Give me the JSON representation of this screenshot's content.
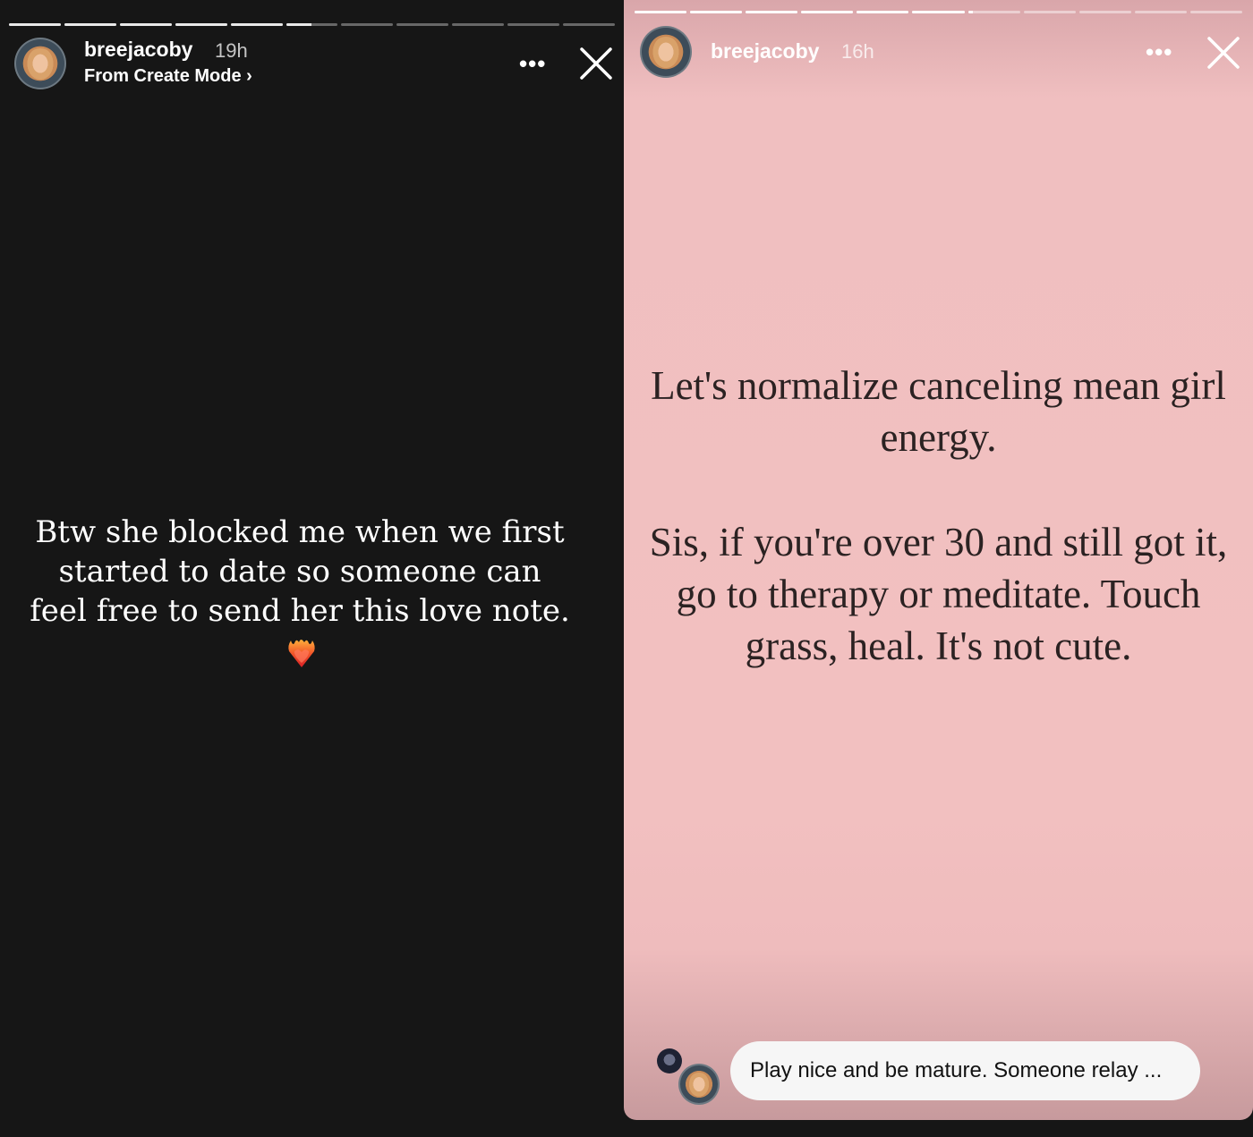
{
  "left_story": {
    "progress": {
      "segments": 11,
      "current": 5,
      "current_fill": 0.5
    },
    "user": {
      "username": "breejacoby",
      "time": "19h",
      "subtitle": "From Create Mode ›"
    },
    "more_label": "•••",
    "caption": "Btw she blocked me when we first started to date so someone can feel free to send her this love note.",
    "emoji": "heart-on-fire-icon",
    "background": "#161616"
  },
  "right_story": {
    "progress": {
      "segments": 11,
      "current": 6,
      "current_fill": 0.1
    },
    "user": {
      "username": "breejacoby",
      "time": "16h"
    },
    "more_label": "•••",
    "quote_line1": "Let's normalize canceling mean girl energy.",
    "quote_line2": "Sis, if you're over 30 and still got it, go to therapy or meditate. Touch grass, heal. It's not cute.",
    "reply": {
      "text": "Play nice and be mature. Someone relay ..."
    },
    "background": "#f2c0c0"
  }
}
